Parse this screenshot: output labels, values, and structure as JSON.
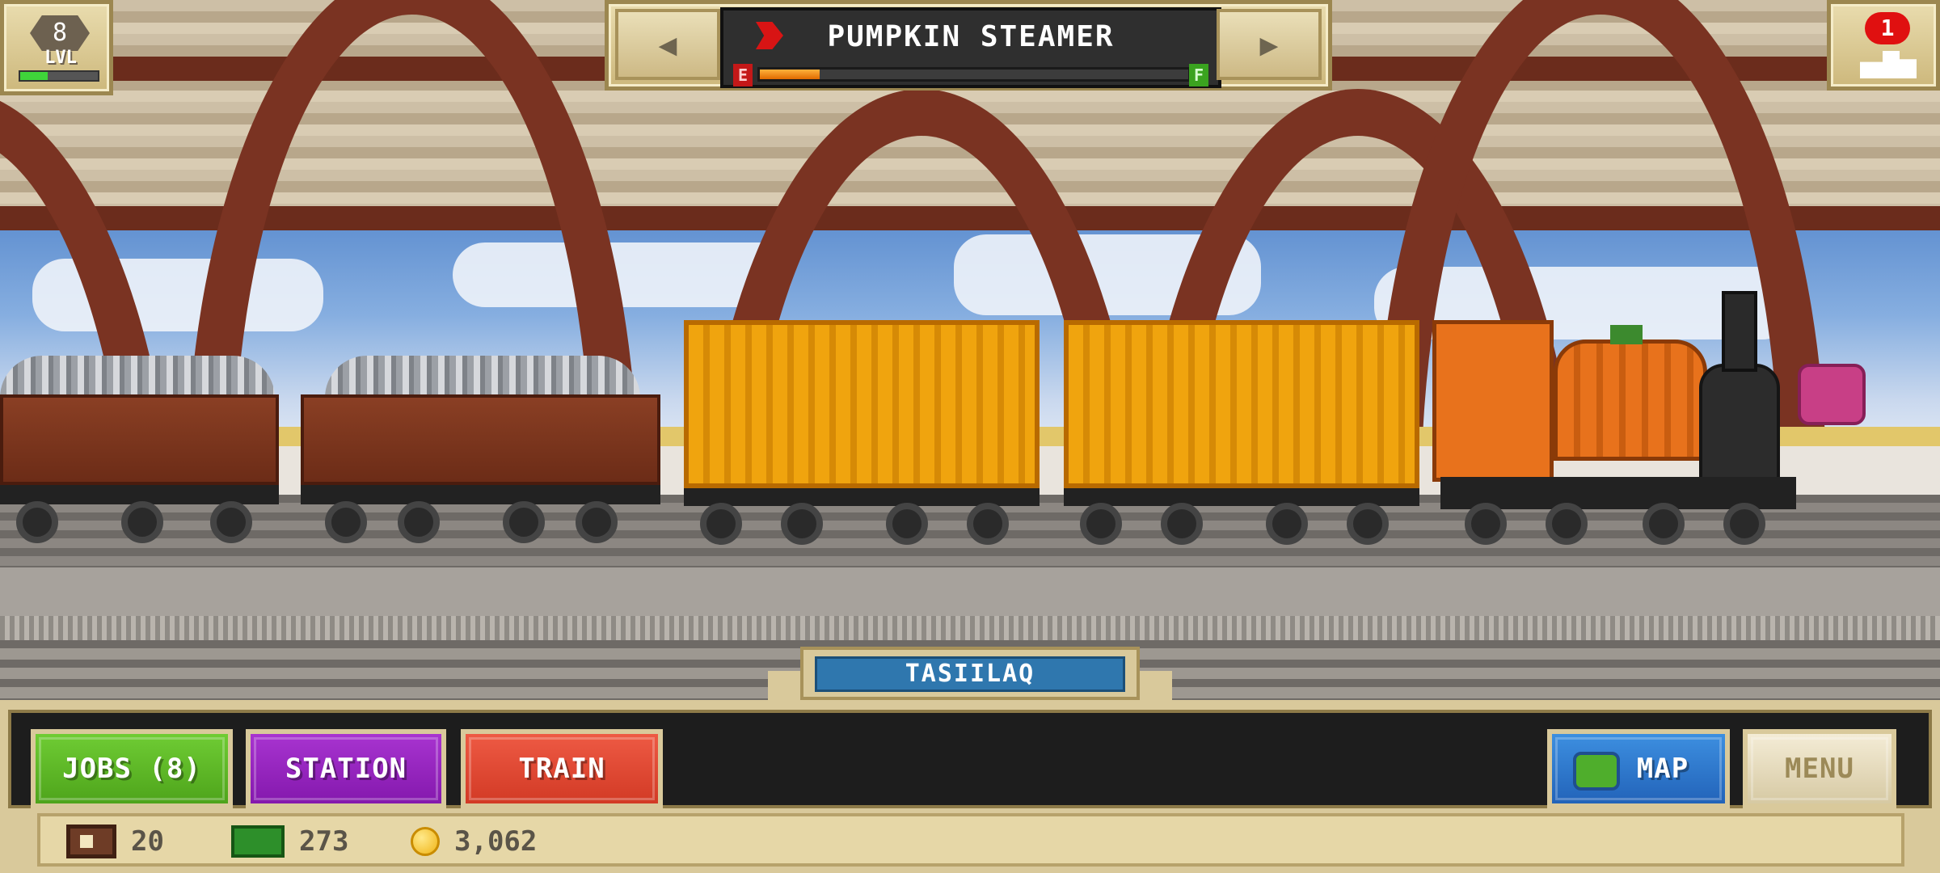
{
  "hud_top": {
    "level": {
      "number": "8",
      "label": "LVL",
      "xp_progress": 0.35
    },
    "train_selector": {
      "prev_icon": "left-triangle-icon",
      "next_icon": "right-triangle-icon",
      "train_name": "PUMPKIN STEAMER",
      "fuel": {
        "empty_label": "E",
        "full_label": "F",
        "level": 0.14
      }
    },
    "notifications": {
      "count": "1",
      "icon": "train-icon"
    }
  },
  "station": {
    "name": "TASIILAQ"
  },
  "bottom_buttons": {
    "jobs": "JOBS (8)",
    "station": "STATION",
    "train": "TRAIN",
    "map": "MAP",
    "menu": "MENU"
  },
  "stats": {
    "cars": "20",
    "cash": "273",
    "coins": "3,062"
  },
  "colors": {
    "jobs_button": "#5cb826",
    "station_button": "#9526be",
    "train_button": "#e14a33",
    "map_button": "#2f79cf",
    "locomotive": "#e8721c",
    "containers": "#f0a40e"
  }
}
